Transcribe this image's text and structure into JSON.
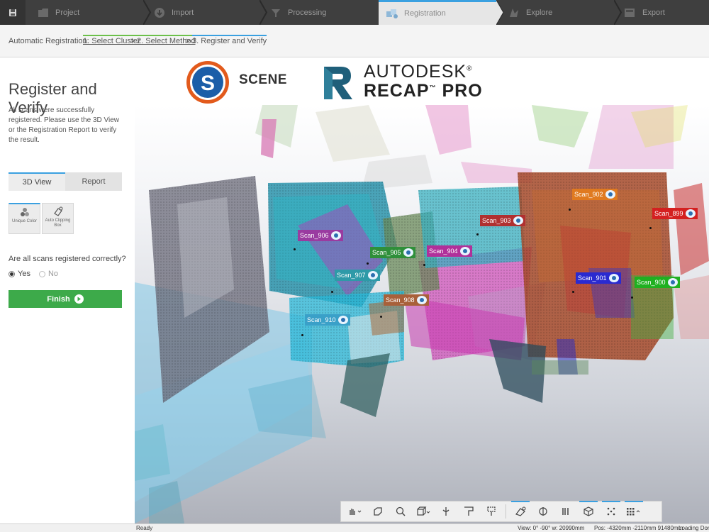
{
  "topbar": {
    "steps": [
      {
        "label": "Project"
      },
      {
        "label": "Import"
      },
      {
        "label": "Processing"
      },
      {
        "label": "Registration"
      },
      {
        "label": "Explore"
      },
      {
        "label": "Export"
      }
    ],
    "active_step": "Registration",
    "accent": "#3aa0e0"
  },
  "breadcrumb": {
    "label": "Automatic Registration:",
    "steps": [
      "1. Select Cluster",
      "2. Select Method",
      "3. Register and Verify"
    ],
    "sep": ">"
  },
  "panel": {
    "title": "Register and Verify",
    "description": "All scans were successfully registered. Please use the 3D View or the Registration Report to verify the result.",
    "tabs": [
      "3D View",
      "Report"
    ],
    "tools": [
      "Unique Color",
      "Auto Clipping Box"
    ],
    "question": "Are all scans registered correctly?",
    "yes": "Yes",
    "no": "No",
    "finish": "Finish",
    "finish_color": "#3daa4a"
  },
  "logos": {
    "scene": "SCENE",
    "scene_letter": "S",
    "recap_line1": "AUTODESK",
    "recap_line1_mark": "®",
    "recap_line2": "RECAP",
    "recap_line2_mark": "™",
    "recap_line2b": "PRO"
  },
  "scans": [
    {
      "label": "Scan_906",
      "color": "#9a3ba0"
    },
    {
      "label": "Scan_905",
      "color": "#2f8f3a"
    },
    {
      "label": "Scan_904",
      "color": "#b0309a"
    },
    {
      "label": "Scan_903",
      "color": "#b03030"
    },
    {
      "label": "Scan_907",
      "color": "#2e9aa8"
    },
    {
      "label": "Scan_908",
      "color": "#a8603a"
    },
    {
      "label": "Scan_910",
      "color": "#3aa0c8"
    },
    {
      "label": "Scan_902",
      "color": "#e07a20"
    },
    {
      "label": "Scan_899",
      "color": "#d42020"
    },
    {
      "label": "Scan_901",
      "color": "#2a2ad0"
    },
    {
      "label": "Scan_900",
      "color": "#20b020"
    }
  ],
  "viewtools": [
    "hand-tool-icon",
    "orbit-icon",
    "zoom-icon",
    "view-cube-icon",
    "walk-icon",
    "fit-icon",
    "limit-box-icon",
    "clip-icon",
    "mirror-icon",
    "columns-icon",
    "cube-icon",
    "points-icon",
    "grid-icon"
  ],
  "status": {
    "ready": "Ready",
    "view": "View: 0° -90° w: 20990mm",
    "pos": "Pos: -4320mm -2110mm 91480mm",
    "loading": "Loading Done"
  }
}
